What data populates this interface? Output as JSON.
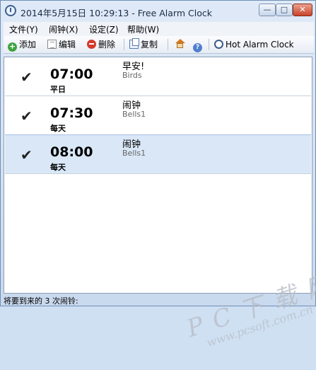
{
  "window": {
    "title": "2014年5月15日  10:29:13 - Free Alarm Clock",
    "min_glyph": "—",
    "max_glyph": "□",
    "close_glyph": "✕"
  },
  "menu": {
    "items": [
      {
        "label": "文件(Y)"
      },
      {
        "label": "闹钟(X)"
      },
      {
        "label": "设定(Z)"
      },
      {
        "label": "帮助(W)"
      }
    ]
  },
  "toolbar": {
    "add_label": "添加",
    "add_icon": "add-icon",
    "edit_label": "编辑",
    "edit_icon": "edit-icon",
    "delete_label": "删除",
    "delete_icon": "delete-icon",
    "copy_label": "复制",
    "copy_icon": "copy-icon",
    "home_icon": "home-icon",
    "help_icon": "help-icon",
    "hot_label": "Hot Alarm Clock",
    "hot_icon": "clock-icon"
  },
  "alarms": [
    {
      "enabled": true,
      "check": "✔",
      "time": "07:00",
      "repeat": "平日",
      "label": "早安!",
      "sound": "Birds"
    },
    {
      "enabled": true,
      "check": "✔",
      "time": "07:30",
      "repeat": "每天",
      "label": "闹钟",
      "sound": "Bells1"
    },
    {
      "enabled": true,
      "check": "✔",
      "time": "08:00",
      "repeat": "每天",
      "label": "闹钟",
      "sound": "Bells1",
      "selected": true
    }
  ],
  "status": {
    "text": "将要到来的 3 次闹铃:"
  },
  "watermark": {
    "line1": "P C 下 载 网",
    "line2": "www.pcsoft.com.cn"
  }
}
